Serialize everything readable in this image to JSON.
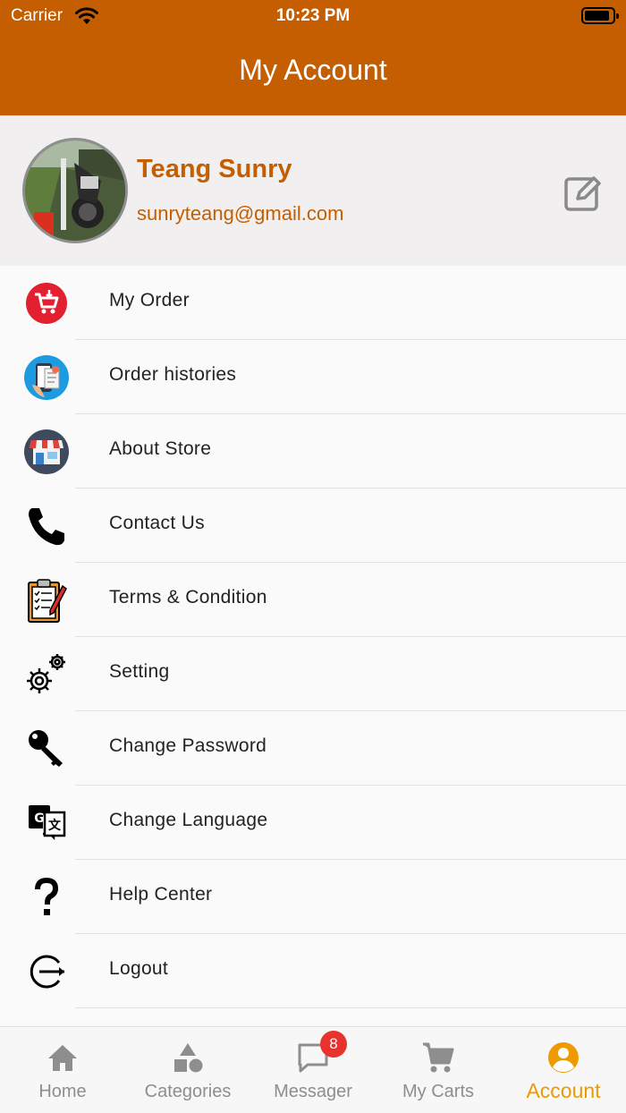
{
  "status_bar": {
    "carrier": "Carrier",
    "time": "10:23 PM"
  },
  "header": {
    "title": "My Account"
  },
  "profile": {
    "name": "Teang Sunry",
    "email": "sunryteang@gmail.com"
  },
  "menu": [
    {
      "label": "My Order",
      "icon": "cart-icon"
    },
    {
      "label": "Order histories",
      "icon": "phone-receipt-icon"
    },
    {
      "label": "About Store",
      "icon": "store-icon"
    },
    {
      "label": "Contact Us",
      "icon": "phone-icon"
    },
    {
      "label": "Terms & Condition",
      "icon": "clipboard-icon"
    },
    {
      "label": "Setting",
      "icon": "gears-icon"
    },
    {
      "label": "Change Password",
      "icon": "key-icon"
    },
    {
      "label": "Change Language",
      "icon": "translate-icon"
    },
    {
      "label": "Help Center",
      "icon": "question-icon"
    },
    {
      "label": "Logout",
      "icon": "logout-icon"
    }
  ],
  "tabs": [
    {
      "label": "Home"
    },
    {
      "label": "Categories"
    },
    {
      "label": "Messager",
      "badge": "8"
    },
    {
      "label": "My Carts"
    },
    {
      "label": "Account"
    }
  ],
  "colors": {
    "brand": "#c45e00",
    "active_tab": "#ee9a00",
    "badge": "#e8322d"
  }
}
